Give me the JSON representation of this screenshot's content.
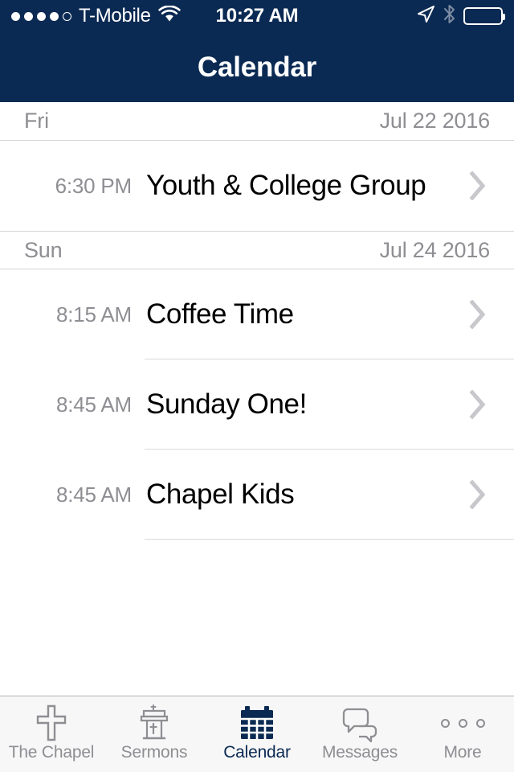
{
  "status_bar": {
    "carrier": "T-Mobile",
    "signal_dots_filled": 4,
    "signal_dots_total": 5,
    "wifi_icon": "wifi-icon",
    "time": "10:27 AM",
    "location_icon": "location-arrow-icon",
    "bluetooth_icon": "bluetooth-icon",
    "battery_icon": "battery-icon"
  },
  "nav_bar": {
    "title": "Calendar",
    "background_color": "#0b2a53"
  },
  "colors": {
    "navy": "#0b2a53",
    "gray_text": "#8e8e93",
    "chevron": "#c7c7cc",
    "separator": "#d4d4d6",
    "tabbar_bg": "#f7f7f7"
  },
  "calendar": {
    "sections": [
      {
        "day": "Fri",
        "date": "Jul 22 2016",
        "events": [
          {
            "time": "6:30 PM",
            "title": "Youth & College Group",
            "chevron": "chevron-right-icon"
          }
        ]
      },
      {
        "day": "Sun",
        "date": "Jul 24 2016",
        "events": [
          {
            "time": "8:15 AM",
            "title": "Coffee Time",
            "chevron": "chevron-right-icon"
          },
          {
            "time": "8:45 AM",
            "title": "Sunday One!",
            "chevron": "chevron-right-icon"
          },
          {
            "time": "8:45 AM",
            "title": "Chapel Kids",
            "chevron": "chevron-right-icon"
          }
        ]
      }
    ]
  },
  "tab_bar": {
    "active_index": 2,
    "items": [
      {
        "label": "The Chapel",
        "icon": "cross-icon"
      },
      {
        "label": "Sermons",
        "icon": "pulpit-icon"
      },
      {
        "label": "Calendar",
        "icon": "calendar-icon"
      },
      {
        "label": "Messages",
        "icon": "chat-bubbles-icon"
      },
      {
        "label": "More",
        "icon": "ellipsis-icon"
      }
    ]
  }
}
